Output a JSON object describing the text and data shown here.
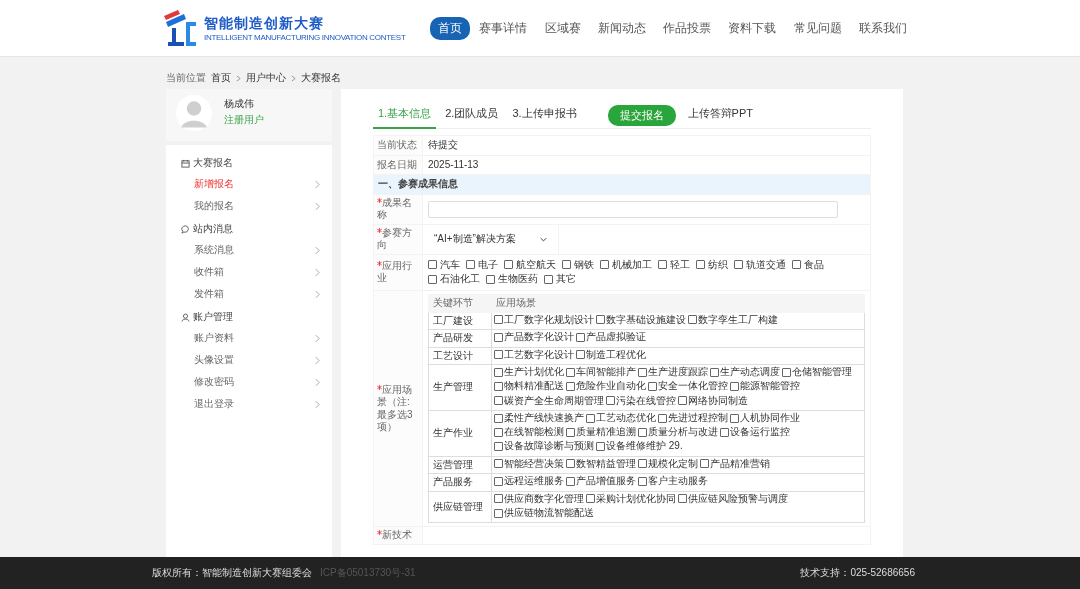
{
  "header": {
    "logo_title": "智能制造创新大赛",
    "logo_subtitle": "INTELLIGENT MANUFACTURING INNOVATION CONTEST",
    "nav": [
      {
        "label": "首页",
        "selected": true
      },
      {
        "label": "赛事详情",
        "selected": false
      },
      {
        "label": "区域赛",
        "selected": false
      },
      {
        "label": "新闻动态",
        "selected": false
      },
      {
        "label": "作品投票",
        "selected": false
      },
      {
        "label": "资料下载",
        "selected": false
      },
      {
        "label": "常见问题",
        "selected": false
      },
      {
        "label": "联系我们",
        "selected": false
      }
    ]
  },
  "breadcrumb": {
    "label": "当前位置",
    "items": [
      "首页",
      "用户中心",
      "大赛报名"
    ]
  },
  "user": {
    "name": "杨成伟",
    "role": "注册用户"
  },
  "sidebar": [
    {
      "title": "大赛报名",
      "kind": "calendar",
      "items": [
        {
          "label": "新增报名",
          "selected": true
        },
        {
          "label": "我的报名",
          "selected": false
        }
      ]
    },
    {
      "title": "站内消息",
      "kind": "message",
      "items": [
        {
          "label": "系统消息",
          "selected": false
        },
        {
          "label": "收件箱",
          "selected": false
        },
        {
          "label": "发件箱",
          "selected": false
        }
      ]
    },
    {
      "title": "账户管理",
      "kind": "user",
      "items": [
        {
          "label": "账户资料",
          "selected": false
        },
        {
          "label": "头像设置",
          "selected": false
        },
        {
          "label": "修改密码",
          "selected": false
        },
        {
          "label": "退出登录",
          "selected": false
        }
      ]
    }
  ],
  "steps": [
    {
      "label": "1.基本信息",
      "selected": true
    },
    {
      "label": "2.团队成员",
      "selected": false
    },
    {
      "label": "3.上传申报书",
      "selected": false
    }
  ],
  "submit_button": "提交报名",
  "upload_link": "上传答辩PPT",
  "info": [
    {
      "label": "当前状态",
      "value": "待提交"
    },
    {
      "label": "报名日期",
      "value": "2025-11-13"
    }
  ],
  "section_title": "一、参赛成果信息",
  "fields": {
    "name": {
      "label": "成果名称",
      "required": true
    },
    "direction": {
      "label": "参赛方向",
      "required": true,
      "value": "“AI+制造”解决方案"
    },
    "industry": {
      "label": "应用行业",
      "required": true,
      "options": [
        {
          "label": "汽车",
          "checked": false
        },
        {
          "label": "电子",
          "checked": false
        },
        {
          "label": "航空航天",
          "checked": false
        },
        {
          "label": "钢铁",
          "checked": false
        },
        {
          "label": "机械加工",
          "checked": false
        },
        {
          "label": "轻工",
          "checked": false
        },
        {
          "label": "纺织",
          "checked": false
        },
        {
          "label": "轨道交通",
          "checked": false
        },
        {
          "label": "食品",
          "checked": false
        },
        {
          "label": "石油化工",
          "checked": false
        },
        {
          "label": "生物医药",
          "checked": false
        },
        {
          "label": "其它",
          "checked": false
        }
      ]
    },
    "scenario": {
      "label": "应用场景（注:最多选3项）",
      "required": true,
      "columns": [
        "关键环节",
        "应用场景"
      ],
      "rows": [
        {
          "stage": "工厂建设",
          "options": [
            {
              "label": "工厂数字化规划设计",
              "checked": false
            },
            {
              "label": "数字基础设施建设",
              "checked": false
            },
            {
              "label": "数字孪生工厂构建",
              "checked": false
            }
          ]
        },
        {
          "stage": "产品研发",
          "options": [
            {
              "label": "产品数字化设计",
              "checked": false
            },
            {
              "label": "产品虚拟验证",
              "checked": false
            }
          ]
        },
        {
          "stage": "工艺设计",
          "options": [
            {
              "label": "工艺数字化设计",
              "checked": false
            },
            {
              "label": "制造工程优化",
              "checked": false
            }
          ]
        },
        {
          "stage": "生产管理",
          "options": [
            {
              "label": "生产计划优化",
              "checked": false
            },
            {
              "label": "车间智能排产",
              "checked": false
            },
            {
              "label": "生产进度跟踪",
              "checked": false
            },
            {
              "label": "生产动态调度",
              "checked": false
            },
            {
              "label": "仓储智能管理",
              "checked": false
            },
            {
              "label": "物料精准配送",
              "checked": false
            },
            {
              "label": "危险作业自动化",
              "checked": false
            },
            {
              "label": "安全一体化管控",
              "checked": false
            },
            {
              "label": "能源智能管控",
              "checked": false
            },
            {
              "label": "碳资产全生命周期管理",
              "checked": false
            },
            {
              "label": "污染在线管控",
              "checked": false
            },
            {
              "label": "网络协同制造",
              "checked": false
            }
          ]
        },
        {
          "stage": "生产作业",
          "options": [
            {
              "label": "柔性产线快速换产",
              "checked": false
            },
            {
              "label": "工艺动态优化",
              "checked": false
            },
            {
              "label": "先进过程控制",
              "checked": false
            },
            {
              "label": "人机协同作业",
              "checked": false
            },
            {
              "label": "在线智能检测",
              "checked": false
            },
            {
              "label": "质量精准追溯",
              "checked": false
            },
            {
              "label": "质量分析与改进",
              "checked": false
            },
            {
              "label": "设备运行监控",
              "checked": false
            },
            {
              "label": "设备故障诊断与预测",
              "checked": false
            },
            {
              "label": "设备维修维护 29.",
              "checked": false
            }
          ]
        },
        {
          "stage": "运营管理",
          "options": [
            {
              "label": "智能经营决策",
              "checked": false
            },
            {
              "label": "数智精益管理",
              "checked": false
            },
            {
              "label": "规模化定制",
              "checked": false
            },
            {
              "label": "产品精准营销",
              "checked": false
            }
          ]
        },
        {
          "stage": "产品服务",
          "options": [
            {
              "label": "远程运维服务",
              "checked": false
            },
            {
              "label": "产品增值服务",
              "checked": false
            },
            {
              "label": "客户主动服务",
              "checked": false
            }
          ]
        },
        {
          "stage": "供应链管理",
          "options": [
            {
              "label": "供应商数字化管理",
              "checked": false
            },
            {
              "label": "采购计划优化协同",
              "checked": false
            },
            {
              "label": "供应链风险预警与调度",
              "checked": false
            },
            {
              "label": "供应链物流智能配送",
              "checked": false
            }
          ]
        }
      ]
    },
    "next": {
      "label": "新技术",
      "required": true
    }
  },
  "footer": {
    "copyright": "版权所有：智能制造创新大赛组委会",
    "icp": "ICP备05013730号-31",
    "support": "技术支持：025-52686656"
  }
}
